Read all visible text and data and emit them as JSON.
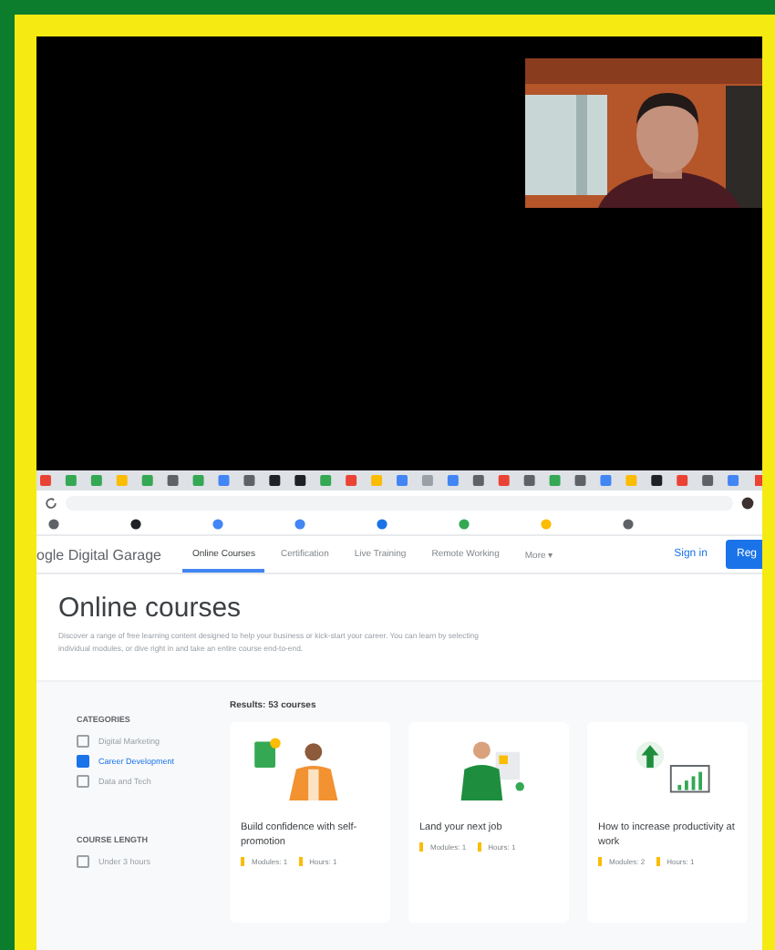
{
  "site": {
    "logo": "ogle Digital Garage",
    "nav": [
      {
        "label": "Online Courses",
        "selected": true
      },
      {
        "label": "Certification",
        "selected": false
      },
      {
        "label": "Live Training",
        "selected": false
      },
      {
        "label": "Remote Working",
        "selected": false
      },
      {
        "label": "More ▾",
        "selected": false
      }
    ],
    "sign_in": "Sign in",
    "register": "Reg"
  },
  "hero": {
    "title": "Online courses",
    "description": "Discover a range of free learning content designed to help your business or kick-start your career. You can learn by selecting individual modules, or dive right in and take an entire course end-to-end."
  },
  "filters": [
    {
      "heading": "CATEGORIES",
      "items": [
        {
          "label": "Digital Marketing",
          "checked": false
        },
        {
          "label": "Career Development",
          "checked": true
        },
        {
          "label": "Data and Tech",
          "checked": false
        }
      ]
    },
    {
      "heading": "COURSE LENGTH",
      "items": [
        {
          "label": "Under 3 hours",
          "checked": false
        }
      ]
    }
  ],
  "results": "Results: 53 courses",
  "courses": [
    {
      "title": "Build confidence with self-promotion",
      "kind": "person-orange",
      "modules": "Modules: 1",
      "hours": "Hours: 1"
    },
    {
      "title": "Land your next job",
      "kind": "person-green",
      "modules": "Modules: 1",
      "hours": "Hours: 1"
    },
    {
      "title": "How to increase productivity at work",
      "kind": "chart",
      "modules": "Modules: 2",
      "hours": "Hours: 1"
    }
  ]
}
